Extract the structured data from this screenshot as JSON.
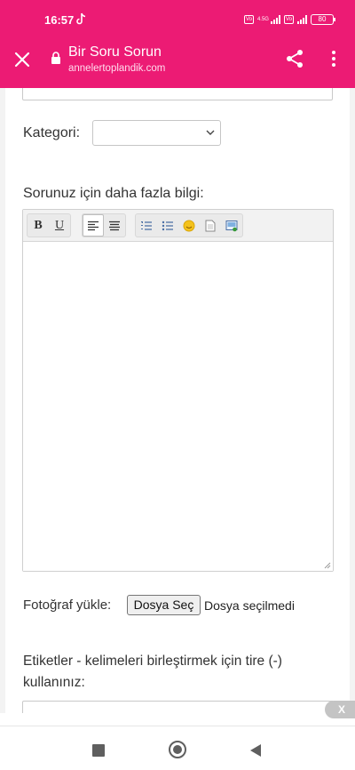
{
  "status_bar": {
    "time": "16:57",
    "network_label": "4.5G",
    "battery": "80"
  },
  "browser": {
    "page_title": "Bir Soru Sorun",
    "url": "annelertoplandik.com"
  },
  "form": {
    "kategori_label": "Kategori:",
    "kategori_selected": "",
    "sorunuz_label": "Sorunuz için daha fazla bilgi:",
    "editor_toolbar": {
      "bold": "B",
      "underline": "U"
    },
    "foto_label": "Fotoğraf yükle:",
    "file_button": "Dosya Seç",
    "file_status": "Dosya seçilmedi",
    "etiket_label": "Etiketler - kelimeleri birleştirmek için tire (-) kullanınız:"
  },
  "overlay": {
    "close_badge": "X"
  },
  "colors": {
    "brand": "#ec1b74"
  }
}
